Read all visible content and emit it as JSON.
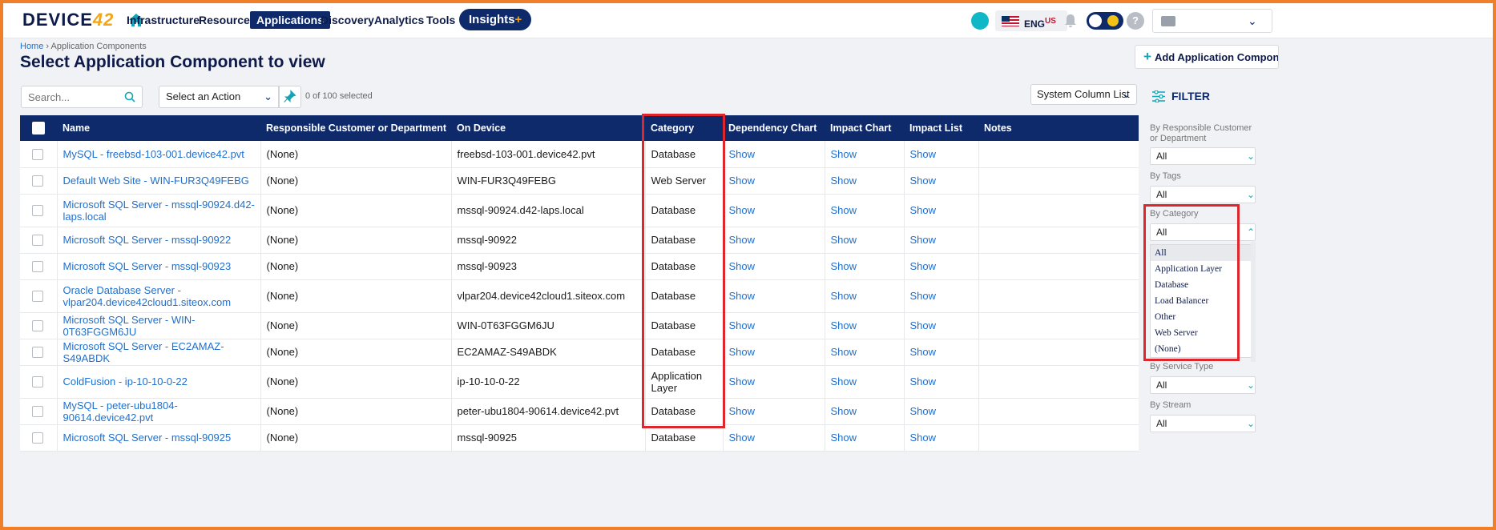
{
  "nav": {
    "logo_main": "DEVICE",
    "logo_num": "42",
    "items": [
      "Infrastructure",
      "Resources",
      "Applications",
      "Discovery",
      "Analytics",
      "Tools"
    ],
    "insights": "Insights",
    "insights_plus": "+",
    "lang": "ENG",
    "lang_region": "US",
    "help": "?"
  },
  "breadcrumb": {
    "home": "Home",
    "sep": " › ",
    "current": "Application Components"
  },
  "title": "Select Application Component to view",
  "add_button": "Add Application Component",
  "toolbar": {
    "search_placeholder": "Search...",
    "action": "Select an Action",
    "selected": "0 of 100 selected",
    "column_list": "System Column List"
  },
  "table": {
    "headers": [
      "Name",
      "Responsible Customer or Department",
      "On Device",
      "Category",
      "Dependency Chart",
      "Impact Chart",
      "Impact List",
      "Notes"
    ],
    "rows": [
      {
        "name": "MySQL - freebsd-103-001.device42.pvt",
        "customer": "(None)",
        "device": "freebsd-103-001.device42.pvt",
        "category": "Database",
        "dep": "Show",
        "impact": "Show",
        "list": "Show"
      },
      {
        "name": "Default Web Site - WIN-FUR3Q49FEBG",
        "customer": "(None)",
        "device": "WIN-FUR3Q49FEBG",
        "category": "Web Server",
        "dep": "Show",
        "impact": "Show",
        "list": "Show"
      },
      {
        "name": "Microsoft SQL Server - mssql-90924.d42-laps.local",
        "customer": "(None)",
        "device": "mssql-90924.d42-laps.local",
        "category": "Database",
        "dep": "Show",
        "impact": "Show",
        "list": "Show"
      },
      {
        "name": "Microsoft SQL Server - mssql-90922",
        "customer": "(None)",
        "device": "mssql-90922",
        "category": "Database",
        "dep": "Show",
        "impact": "Show",
        "list": "Show"
      },
      {
        "name": "Microsoft SQL Server - mssql-90923",
        "customer": "(None)",
        "device": "mssql-90923",
        "category": "Database",
        "dep": "Show",
        "impact": "Show",
        "list": "Show"
      },
      {
        "name": "Oracle Database Server - vlpar204.device42cloud1.siteox.com",
        "customer": "(None)",
        "device": "vlpar204.device42cloud1.siteox.com",
        "category": "Database",
        "dep": "Show",
        "impact": "Show",
        "list": "Show"
      },
      {
        "name": "Microsoft SQL Server - WIN-0T63FGGM6JU",
        "customer": "(None)",
        "device": "WIN-0T63FGGM6JU",
        "category": "Database",
        "dep": "Show",
        "impact": "Show",
        "list": "Show"
      },
      {
        "name": "Microsoft SQL Server - EC2AMAZ-S49ABDK",
        "customer": "(None)",
        "device": "EC2AMAZ-S49ABDK",
        "category": "Database",
        "dep": "Show",
        "impact": "Show",
        "list": "Show"
      },
      {
        "name": "ColdFusion - ip-10-10-0-22",
        "customer": "(None)",
        "device": "ip-10-10-0-22",
        "category": "Application Layer",
        "dep": "Show",
        "impact": "Show",
        "list": "Show"
      },
      {
        "name": "MySQL - peter-ubu1804-90614.device42.pvt",
        "customer": "(None)",
        "device": "peter-ubu1804-90614.device42.pvt",
        "category": "Database",
        "dep": "Show",
        "impact": "Show",
        "list": "Show"
      },
      {
        "name": "Microsoft SQL Server - mssql-90925",
        "customer": "(None)",
        "device": "mssql-90925",
        "category": "Database",
        "dep": "Show",
        "impact": "Show",
        "list": "Show"
      }
    ]
  },
  "filter": {
    "title": "FILTER",
    "customer_label": "By Responsible Customer or Department",
    "customer_value": "All",
    "tags_label": "By Tags",
    "tags_value": "All",
    "category_label": "By Category",
    "category_value": "All",
    "category_options": [
      "All",
      "Application Layer",
      "Database",
      "Load Balancer",
      "Other",
      "Web Server",
      "(None)"
    ],
    "service_label": "By Service Type",
    "service_value": "All",
    "stream_label": "By Stream",
    "stream_value": "All"
  },
  "colors": {
    "navy": "#0e2a6b",
    "link": "#1f6fce",
    "highlight": "#e0262d",
    "frame": "#f07f2a",
    "accent": "#10a5b7"
  }
}
